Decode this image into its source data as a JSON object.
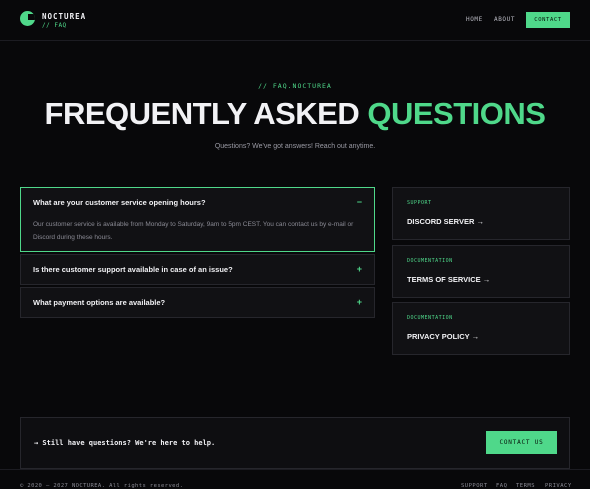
{
  "brand": {
    "name": "NOCTUREA",
    "tag": "// FAQ",
    "logo_icon": "logo-mark-icon"
  },
  "nav": {
    "home": "HOME",
    "about": "ABOUT",
    "contact": "CONTACT"
  },
  "hero": {
    "eyebrow": "// FAQ.NOCTUREA",
    "title_main": "FREQUENTLY ASKED",
    "title_accent": "QUESTIONS",
    "subtitle": "Questions? We've got answers! Reach out anytime."
  },
  "faq": {
    "items": [
      {
        "question": "What are your customer service opening hours?",
        "toggle": "−",
        "answer": "Our customer service is available from Monday to Saturday, 9am to 5pm CEST. You can contact us by e-mail or Discord during these hours."
      },
      {
        "question": "Is there customer support available in case of an issue?",
        "toggle": "+"
      },
      {
        "question": "What payment options are available?",
        "toggle": "+"
      }
    ]
  },
  "side_links": [
    {
      "kicker": "SUPPORT",
      "title": "DISCORD SERVER →"
    },
    {
      "kicker": "DOCUMENTATION",
      "title": "TERMS OF SERVICE →"
    },
    {
      "kicker": "DOCUMENTATION",
      "title": "PRIVACY POLICY →"
    }
  ],
  "cta": {
    "text": "→ Still have questions? We're here to help.",
    "button": "CONTACT US"
  },
  "footer": {
    "copyright": "© 2020 – 2027 NOCTUREA. All rights reserved.",
    "links": [
      "SUPPORT",
      "FAQ",
      "TERMS",
      "PRIVACY"
    ]
  },
  "colors": {
    "accent": "#4fd88a",
    "background": "#08080a",
    "card": "#111114"
  }
}
